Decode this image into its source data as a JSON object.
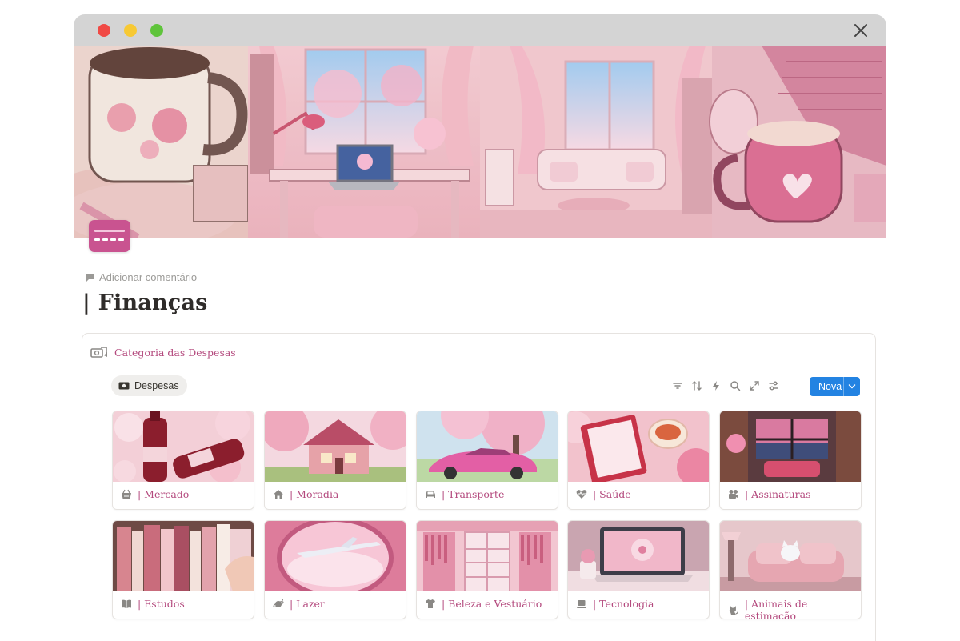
{
  "page": {
    "comment_label": "Adicionar comentário",
    "title": "| Finanças"
  },
  "database": {
    "title": "Categoria das Despesas",
    "view_tab": "Despesas",
    "new_button": "Nova",
    "toolbar_icons": [
      "filter-icon",
      "sort-icon",
      "automation-icon",
      "search-icon",
      "expand-icon",
      "settings-icon"
    ]
  },
  "cards": [
    {
      "label": "| Mercado",
      "icon": "grocery-basket-icon"
    },
    {
      "label": "| Moradia",
      "icon": "home-icon"
    },
    {
      "label": "| Transporte",
      "icon": "car-icon"
    },
    {
      "label": "| Saúde",
      "icon": "heart-pulse-icon"
    },
    {
      "label": "| Assinaturas",
      "icon": "projector-icon"
    },
    {
      "label": "| Estudos",
      "icon": "book-icon"
    },
    {
      "label": "| Lazer",
      "icon": "planet-icon"
    },
    {
      "label": "| Beleza e Vestuário",
      "icon": "shirt-icon"
    },
    {
      "label": "| Tecnologia",
      "icon": "laptop-icon"
    },
    {
      "label": "| Animais de estimação",
      "icon": "cat-icon"
    }
  ],
  "colors": {
    "accent": "#b44a7e",
    "page_icon": "#c95390",
    "button": "#2383e2"
  }
}
